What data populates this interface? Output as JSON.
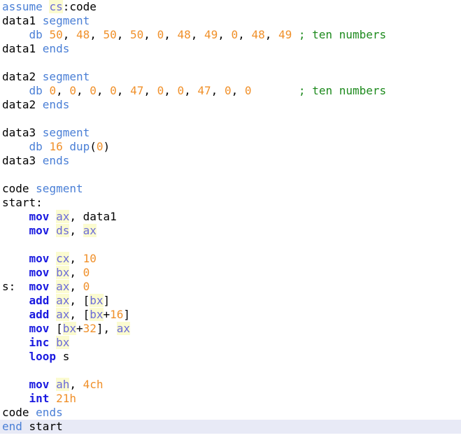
{
  "editor": {
    "current_line": 30,
    "lines": [
      [
        {
          "t": "assume",
          "c": "kw"
        },
        {
          "t": " ",
          "c": "pl"
        },
        {
          "t": "cs",
          "c": "reg"
        },
        {
          "t": ":code",
          "c": "pl"
        }
      ],
      [
        {
          "t": "data1 ",
          "c": "pl"
        },
        {
          "t": "segment",
          "c": "kw"
        }
      ],
      [
        {
          "t": "    ",
          "c": "pl"
        },
        {
          "t": "db",
          "c": "kw"
        },
        {
          "t": " ",
          "c": "pl"
        },
        {
          "t": "50",
          "c": "num"
        },
        {
          "t": ", ",
          "c": "pl"
        },
        {
          "t": "48",
          "c": "num"
        },
        {
          "t": ", ",
          "c": "pl"
        },
        {
          "t": "50",
          "c": "num"
        },
        {
          "t": ", ",
          "c": "pl"
        },
        {
          "t": "50",
          "c": "num"
        },
        {
          "t": ", ",
          "c": "pl"
        },
        {
          "t": "0",
          "c": "num"
        },
        {
          "t": ", ",
          "c": "pl"
        },
        {
          "t": "48",
          "c": "num"
        },
        {
          "t": ", ",
          "c": "pl"
        },
        {
          "t": "49",
          "c": "num"
        },
        {
          "t": ", ",
          "c": "pl"
        },
        {
          "t": "0",
          "c": "num"
        },
        {
          "t": ", ",
          "c": "pl"
        },
        {
          "t": "48",
          "c": "num"
        },
        {
          "t": ", ",
          "c": "pl"
        },
        {
          "t": "49",
          "c": "num"
        },
        {
          "t": " ",
          "c": "pl"
        },
        {
          "t": "; ten numbers",
          "c": "cm"
        }
      ],
      [
        {
          "t": "data1 ",
          "c": "pl"
        },
        {
          "t": "ends",
          "c": "kw"
        }
      ],
      [],
      [
        {
          "t": "data2 ",
          "c": "pl"
        },
        {
          "t": "segment",
          "c": "kw"
        }
      ],
      [
        {
          "t": "    ",
          "c": "pl"
        },
        {
          "t": "db",
          "c": "kw"
        },
        {
          "t": " ",
          "c": "pl"
        },
        {
          "t": "0",
          "c": "num"
        },
        {
          "t": ", ",
          "c": "pl"
        },
        {
          "t": "0",
          "c": "num"
        },
        {
          "t": ", ",
          "c": "pl"
        },
        {
          "t": "0",
          "c": "num"
        },
        {
          "t": ", ",
          "c": "pl"
        },
        {
          "t": "0",
          "c": "num"
        },
        {
          "t": ", ",
          "c": "pl"
        },
        {
          "t": "47",
          "c": "num"
        },
        {
          "t": ", ",
          "c": "pl"
        },
        {
          "t": "0",
          "c": "num"
        },
        {
          "t": ", ",
          "c": "pl"
        },
        {
          "t": "0",
          "c": "num"
        },
        {
          "t": ", ",
          "c": "pl"
        },
        {
          "t": "47",
          "c": "num"
        },
        {
          "t": ", ",
          "c": "pl"
        },
        {
          "t": "0",
          "c": "num"
        },
        {
          "t": ", ",
          "c": "pl"
        },
        {
          "t": "0",
          "c": "num"
        },
        {
          "t": "       ",
          "c": "pl"
        },
        {
          "t": "; ten numbers",
          "c": "cm"
        }
      ],
      [
        {
          "t": "data2 ",
          "c": "pl"
        },
        {
          "t": "ends",
          "c": "kw"
        }
      ],
      [],
      [
        {
          "t": "data3 ",
          "c": "pl"
        },
        {
          "t": "segment",
          "c": "kw"
        }
      ],
      [
        {
          "t": "    ",
          "c": "pl"
        },
        {
          "t": "db",
          "c": "kw"
        },
        {
          "t": " ",
          "c": "pl"
        },
        {
          "t": "16",
          "c": "num"
        },
        {
          "t": " ",
          "c": "pl"
        },
        {
          "t": "dup",
          "c": "kw"
        },
        {
          "t": "(",
          "c": "pl"
        },
        {
          "t": "0",
          "c": "num"
        },
        {
          "t": ")",
          "c": "pl"
        }
      ],
      [
        {
          "t": "data3 ",
          "c": "pl"
        },
        {
          "t": "ends",
          "c": "kw"
        }
      ],
      [],
      [
        {
          "t": "code ",
          "c": "pl"
        },
        {
          "t": "segment",
          "c": "kw"
        }
      ],
      [
        {
          "t": "start:",
          "c": "pl"
        }
      ],
      [
        {
          "t": "    ",
          "c": "pl"
        },
        {
          "t": "mov",
          "c": "ins"
        },
        {
          "t": " ",
          "c": "pl"
        },
        {
          "t": "ax",
          "c": "reg"
        },
        {
          "t": ", data1",
          "c": "pl"
        }
      ],
      [
        {
          "t": "    ",
          "c": "pl"
        },
        {
          "t": "mov",
          "c": "ins"
        },
        {
          "t": " ",
          "c": "pl"
        },
        {
          "t": "ds",
          "c": "reg"
        },
        {
          "t": ", ",
          "c": "pl"
        },
        {
          "t": "ax",
          "c": "reg"
        }
      ],
      [],
      [
        {
          "t": "    ",
          "c": "pl"
        },
        {
          "t": "mov",
          "c": "ins"
        },
        {
          "t": " ",
          "c": "pl"
        },
        {
          "t": "cx",
          "c": "reg"
        },
        {
          "t": ", ",
          "c": "pl"
        },
        {
          "t": "10",
          "c": "num"
        }
      ],
      [
        {
          "t": "    ",
          "c": "pl"
        },
        {
          "t": "mov",
          "c": "ins"
        },
        {
          "t": " ",
          "c": "pl"
        },
        {
          "t": "bx",
          "c": "reg"
        },
        {
          "t": ", ",
          "c": "pl"
        },
        {
          "t": "0",
          "c": "num"
        }
      ],
      [
        {
          "t": "s:  ",
          "c": "pl"
        },
        {
          "t": "mov",
          "c": "ins"
        },
        {
          "t": " ",
          "c": "pl"
        },
        {
          "t": "ax",
          "c": "reg"
        },
        {
          "t": ", ",
          "c": "pl"
        },
        {
          "t": "0",
          "c": "num"
        }
      ],
      [
        {
          "t": "    ",
          "c": "pl"
        },
        {
          "t": "add",
          "c": "ins"
        },
        {
          "t": " ",
          "c": "pl"
        },
        {
          "t": "ax",
          "c": "reg"
        },
        {
          "t": ", [",
          "c": "pl"
        },
        {
          "t": "bx",
          "c": "reg"
        },
        {
          "t": "]",
          "c": "pl"
        }
      ],
      [
        {
          "t": "    ",
          "c": "pl"
        },
        {
          "t": "add",
          "c": "ins"
        },
        {
          "t": " ",
          "c": "pl"
        },
        {
          "t": "ax",
          "c": "reg"
        },
        {
          "t": ", [",
          "c": "pl"
        },
        {
          "t": "bx",
          "c": "reg"
        },
        {
          "t": "+",
          "c": "pl"
        },
        {
          "t": "16",
          "c": "num"
        },
        {
          "t": "]",
          "c": "pl"
        }
      ],
      [
        {
          "t": "    ",
          "c": "pl"
        },
        {
          "t": "mov",
          "c": "ins"
        },
        {
          "t": " [",
          "c": "pl"
        },
        {
          "t": "bx",
          "c": "reg"
        },
        {
          "t": "+",
          "c": "pl"
        },
        {
          "t": "32",
          "c": "num"
        },
        {
          "t": "], ",
          "c": "pl"
        },
        {
          "t": "ax",
          "c": "reg"
        }
      ],
      [
        {
          "t": "    ",
          "c": "pl"
        },
        {
          "t": "inc",
          "c": "ins"
        },
        {
          "t": " ",
          "c": "pl"
        },
        {
          "t": "bx",
          "c": "reg"
        }
      ],
      [
        {
          "t": "    ",
          "c": "pl"
        },
        {
          "t": "loop",
          "c": "ins"
        },
        {
          "t": " s",
          "c": "pl"
        }
      ],
      [],
      [
        {
          "t": "    ",
          "c": "pl"
        },
        {
          "t": "mov",
          "c": "ins"
        },
        {
          "t": " ",
          "c": "pl"
        },
        {
          "t": "ah",
          "c": "reg"
        },
        {
          "t": ", ",
          "c": "pl"
        },
        {
          "t": "4ch",
          "c": "num"
        }
      ],
      [
        {
          "t": "    ",
          "c": "pl"
        },
        {
          "t": "int",
          "c": "ins"
        },
        {
          "t": " ",
          "c": "pl"
        },
        {
          "t": "21h",
          "c": "num"
        }
      ],
      [
        {
          "t": "code ",
          "c": "pl"
        },
        {
          "t": "ends",
          "c": "kw"
        }
      ],
      [
        {
          "t": "end",
          "c": "kw"
        },
        {
          "t": " start",
          "c": "pl"
        }
      ]
    ]
  }
}
